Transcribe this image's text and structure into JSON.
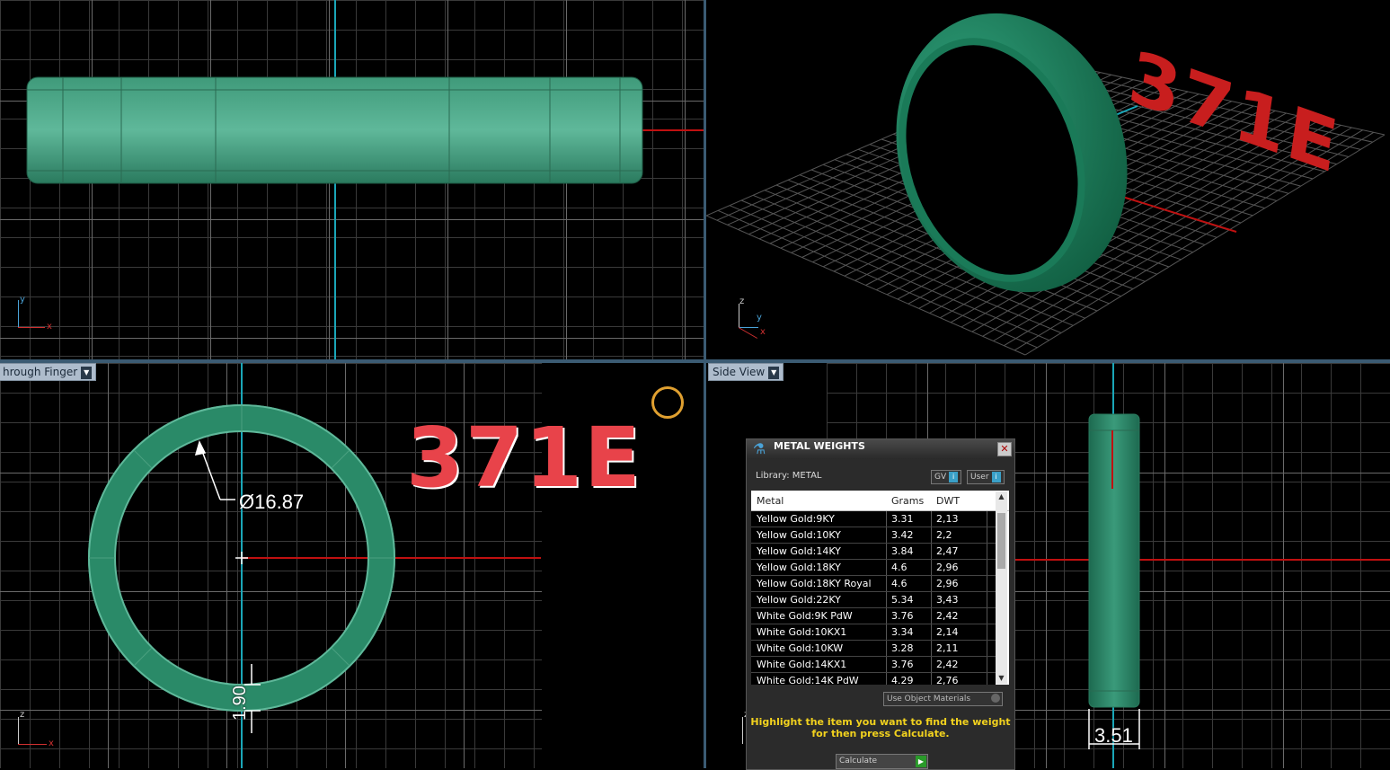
{
  "viewports": {
    "top_left": {
      "gizmo": {
        "axis_v": "y",
        "axis_h": "x"
      }
    },
    "top_right": {
      "model_label": "371E",
      "gizmo": {
        "axis_z": "z",
        "axis_y": "y",
        "axis_x": "x"
      }
    },
    "bottom_left": {
      "view_name": "hrough Finger",
      "model_label": "371E",
      "diameter_dim": "Ø16.87",
      "thickness_dim": "1.90",
      "gizmo": {
        "axis_v": "z",
        "axis_h": "x"
      },
      "icon": "ring-icon"
    },
    "bottom_right": {
      "view_name": "Side View",
      "width_dim": "3.51",
      "gizmo": {
        "axis_v": "z"
      }
    }
  },
  "metal_weights": {
    "title": "METAL WEIGHTS",
    "library": "Library: METAL",
    "gv_button": "GV",
    "user_button": "User",
    "columns": [
      "Metal",
      "Grams",
      "DWT"
    ],
    "rows": [
      [
        "Yellow Gold:9KY",
        "3.31",
        "2,13"
      ],
      [
        "Yellow Gold:10KY",
        "3.42",
        "2,2"
      ],
      [
        "Yellow Gold:14KY",
        "3.84",
        "2,47"
      ],
      [
        "Yellow Gold:18KY",
        "4.6",
        "2,96"
      ],
      [
        "Yellow Gold:18KY Royal",
        "4.6",
        "2,96"
      ],
      [
        "Yellow Gold:22KY",
        "5.34",
        "3,43"
      ],
      [
        "White Gold:9K PdW",
        "3.76",
        "2,42"
      ],
      [
        "White Gold:10KX1",
        "3.34",
        "2,14"
      ],
      [
        "White Gold:10KW",
        "3.28",
        "2,11"
      ],
      [
        "White Gold:14KX1",
        "3.76",
        "2,42"
      ],
      [
        "White Gold:14K PdW",
        "4.29",
        "2,76"
      ]
    ],
    "use_object_materials": "Use Object Materials",
    "hint": "Highlight the item you want to find the weight for then press Calculate.",
    "calculate_button": "Calculate"
  },
  "colors": {
    "ring": "#1f7a5a",
    "grid_axis_vertical": "#1aa6b8",
    "grid_axis_horizontal": "#c01010",
    "label_red": "#e02828",
    "hint_yellow": "#f2d21e"
  }
}
